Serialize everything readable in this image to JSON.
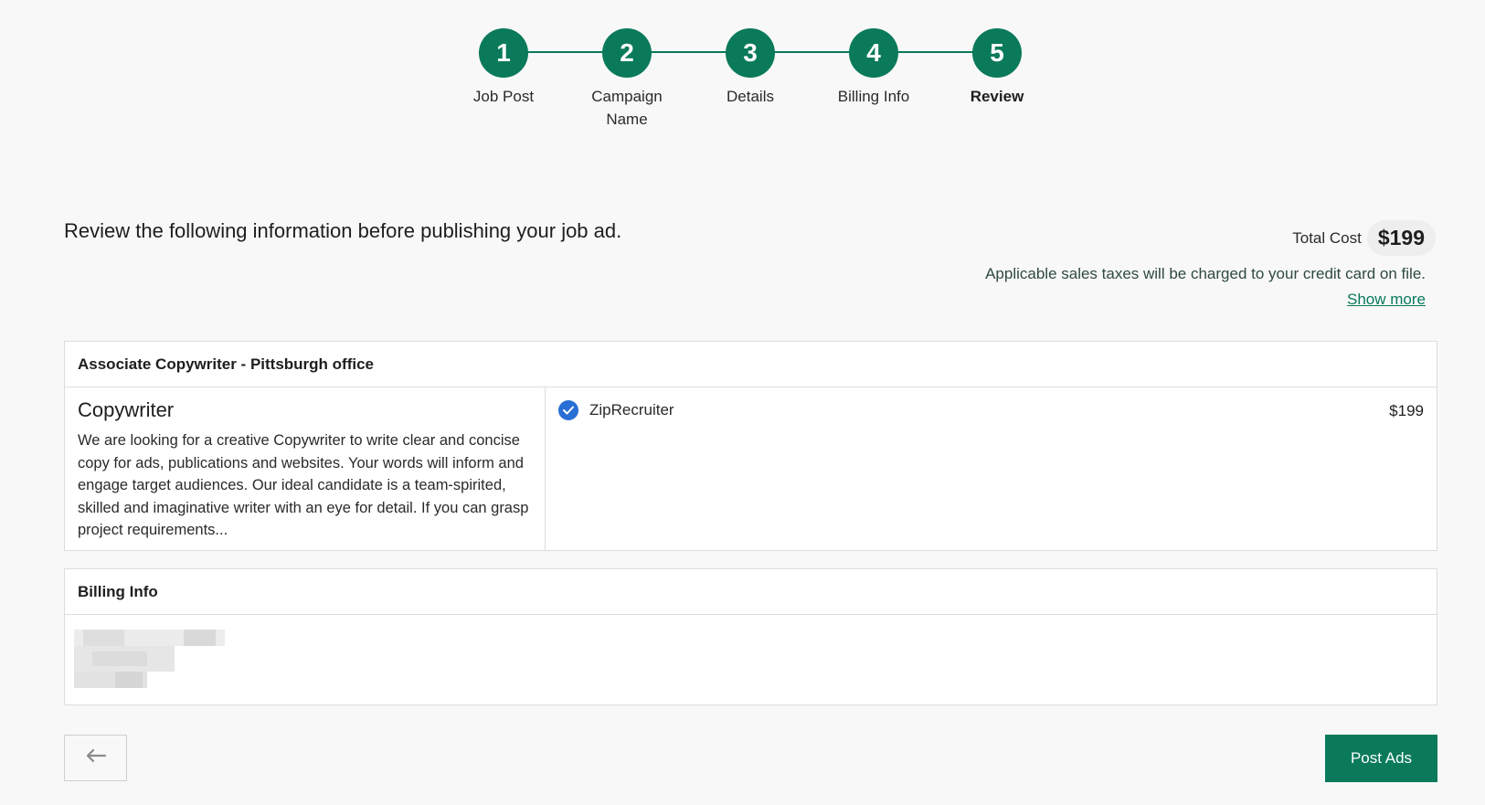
{
  "stepper": {
    "steps": [
      {
        "number": "1",
        "label": "Job Post"
      },
      {
        "number": "2",
        "label": "Campaign Name"
      },
      {
        "number": "3",
        "label": "Details"
      },
      {
        "number": "4",
        "label": "Billing Info"
      },
      {
        "number": "5",
        "label": "Review",
        "active": true
      }
    ]
  },
  "review": {
    "title": "Review the following information before publishing your job ad.",
    "total_cost_label": "Total Cost",
    "total_cost_value": "$199",
    "tax_note": "Applicable sales taxes will be charged to your credit card on file.",
    "show_more": "Show more"
  },
  "job": {
    "header": "Associate Copywriter - Pittsburgh office",
    "title": "Copywriter",
    "description": "We are looking for a creative Copywriter to write clear and concise copy for ads, publications and websites. Your words will inform and engage target audiences. Our ideal candidate is a team-spirited, skilled and imaginative writer with an eye for detail. If you can grasp project requirements...",
    "boards": [
      {
        "name": "ZipRecruiter",
        "price": "$199",
        "checked": true
      }
    ]
  },
  "billing": {
    "header": "Billing Info"
  },
  "footer": {
    "back_icon": "arrow-left-icon",
    "post_label": "Post Ads"
  },
  "colors": {
    "accent": "#0a7a5a",
    "check": "#2a6fd6"
  }
}
